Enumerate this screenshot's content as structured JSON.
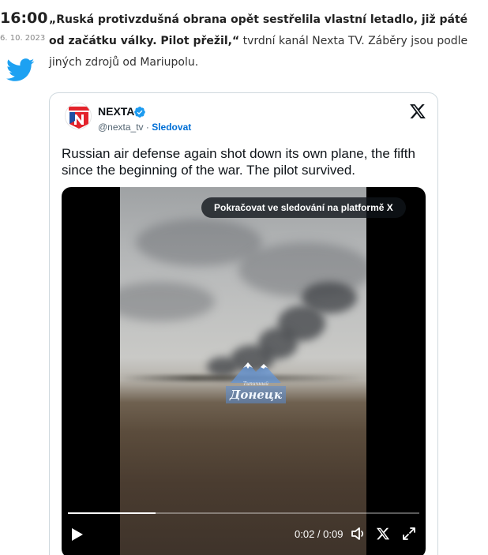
{
  "entry": {
    "time": "16:00",
    "date": "6. 10. 2023",
    "headline_bold": "„Ruská protivzdušná obrana opět sestřelila vlastní letadlo, již páté od začátku války. Pilot přežil,“",
    "headline_rest": " tvrdní kanál Nexta TV. Záběry jsou podle jiných zdrojů od Mariupolu."
  },
  "tweet": {
    "author": "NEXTA",
    "handle": "@nexta_tv",
    "separator": " · ",
    "follow_label": "Sledovat",
    "text": "Russian air defense again shot down its own plane, the fifth since the beginning of the war. The pilot survived.",
    "video": {
      "continue_label": "Pokračovat ve sledování na platformě X",
      "watermark_small": "Типичный",
      "watermark_text": "Донецк",
      "current_time": "0:02",
      "duration": "0:09",
      "time_separator": " / ",
      "progress": 0.25
    }
  },
  "colors": {
    "twitter_blue": "#1da1f2",
    "verified_blue": "#1d9bf0",
    "link_blue": "#006fd6",
    "nexta_red": "#e3232b"
  },
  "icons": {
    "bird": "twitter-bird-icon",
    "verified": "verified-badge-icon",
    "x": "x-logo-icon",
    "play": "play-icon",
    "volume": "volume-icon",
    "fullscreen": "fullscreen-icon"
  }
}
